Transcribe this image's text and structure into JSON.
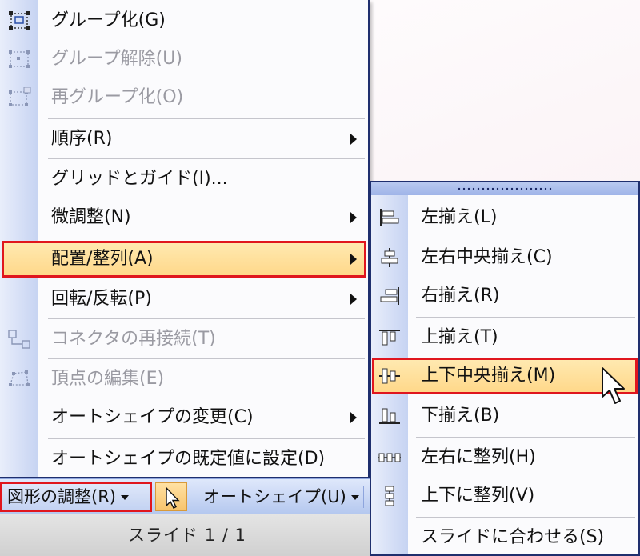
{
  "menu": {
    "items": [
      {
        "label": "グループ化(G)",
        "icon": "group-icon",
        "disabled": false,
        "submenu": false
      },
      {
        "label": "グループ解除(U)",
        "icon": "ungroup-icon",
        "disabled": true,
        "submenu": false
      },
      {
        "label": "再グループ化(O)",
        "icon": "regroup-icon",
        "disabled": true,
        "submenu": false
      },
      {
        "label": "順序(R)",
        "icon": "",
        "disabled": false,
        "submenu": true
      },
      {
        "label": "グリッドとガイド(I)...",
        "icon": "",
        "disabled": false,
        "submenu": false
      },
      {
        "label": "微調整(N)",
        "icon": "",
        "disabled": false,
        "submenu": true
      },
      {
        "label": "配置/整列(A)",
        "icon": "",
        "disabled": false,
        "submenu": true,
        "highlighted": true
      },
      {
        "label": "回転/反転(P)",
        "icon": "",
        "disabled": false,
        "submenu": true
      },
      {
        "label": "コネクタの再接続(T)",
        "icon": "reroute-connector-icon",
        "disabled": true,
        "submenu": false
      },
      {
        "label": "頂点の編集(E)",
        "icon": "edit-points-icon",
        "disabled": true,
        "submenu": false
      },
      {
        "label": "オートシェイプの変更(C)",
        "icon": "",
        "disabled": false,
        "submenu": true
      },
      {
        "label": "オートシェイプの既定値に設定(D)",
        "icon": "",
        "disabled": false,
        "submenu": false
      }
    ]
  },
  "submenu": {
    "items": [
      {
        "label": "左揃え(L)",
        "icon": "align-left-icon"
      },
      {
        "label": "左右中央揃え(C)",
        "icon": "align-center-icon"
      },
      {
        "label": "右揃え(R)",
        "icon": "align-right-icon"
      },
      {
        "label": "上揃え(T)",
        "icon": "align-top-icon"
      },
      {
        "label": "上下中央揃え(M)",
        "icon": "align-middle-icon",
        "highlighted": true
      },
      {
        "label": "下揃え(B)",
        "icon": "align-bottom-icon"
      },
      {
        "label": "左右に整列(H)",
        "icon": "distribute-horizontal-icon"
      },
      {
        "label": "上下に整列(V)",
        "icon": "distribute-vertical-icon"
      },
      {
        "label": "スライドに合わせる(S)",
        "icon": ""
      }
    ]
  },
  "toolbar": {
    "draw_label": "図形の調整(R)",
    "autoshape_label": "オートシェイプ(U)"
  },
  "status": {
    "slide_text": "スライド 1  /  1"
  },
  "colors": {
    "highlight_fill": "#ffd88a",
    "callout_red": "#e0161e",
    "menu_border": "#1f2f6e",
    "strip_blue": "#c6d3f2"
  }
}
